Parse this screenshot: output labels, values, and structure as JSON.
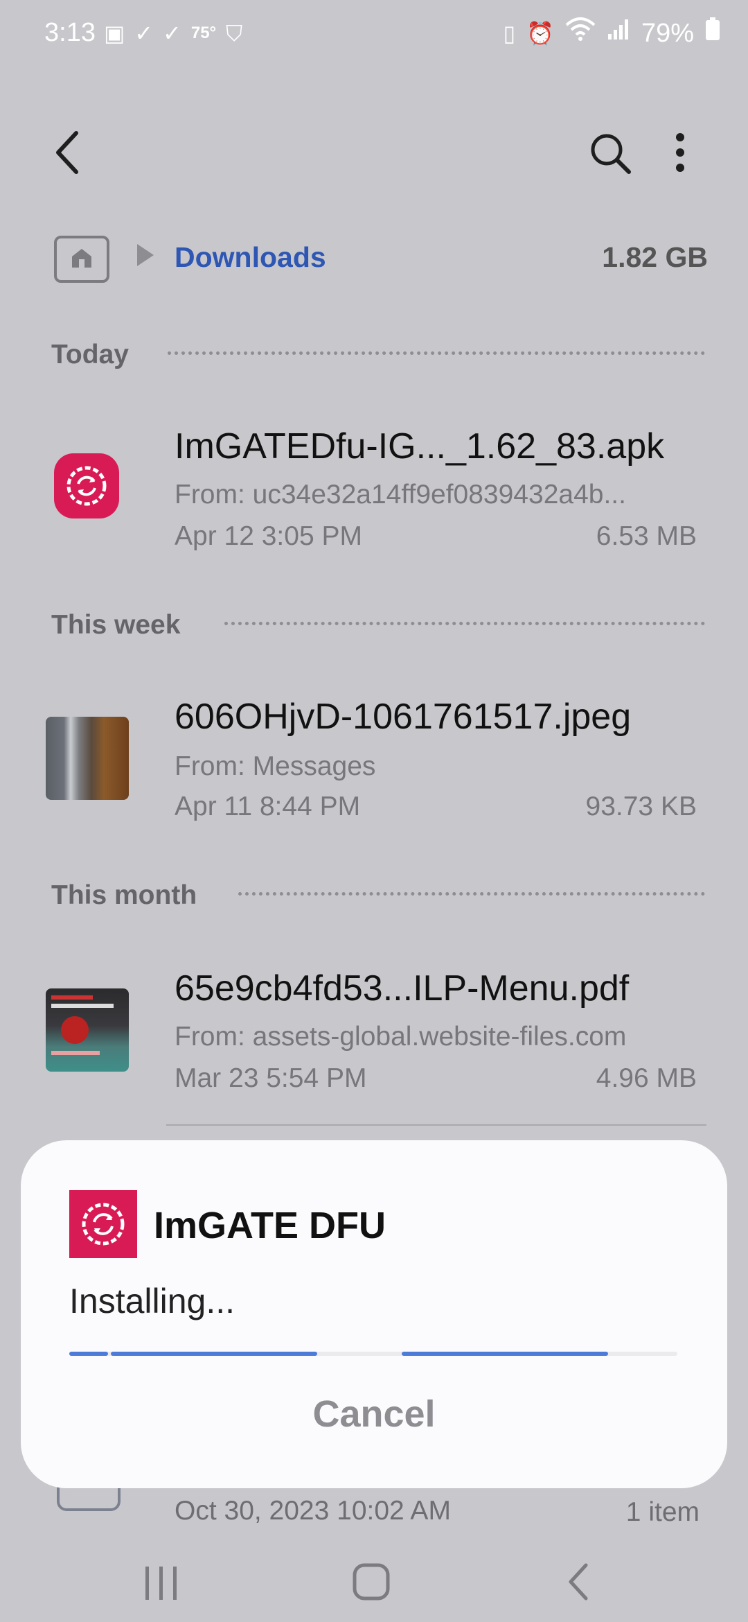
{
  "status_bar": {
    "time": "3:13",
    "temperature": "75°",
    "battery": "79%"
  },
  "toolbar": {
    "back_icon": "chevron-left-icon",
    "search_icon": "search-icon",
    "more_icon": "more-vertical-icon"
  },
  "breadcrumb": {
    "current": "Downloads",
    "storage": "1.82 GB"
  },
  "sections": {
    "today": "Today",
    "this_week": "This week",
    "this_month": "This month"
  },
  "files": [
    {
      "name": "ImGATEDfu-IG..._1.62_83.apk",
      "from": "From: uc34e32a14ff9ef0839432a4b...",
      "date": "Apr 12 3:05 PM",
      "size": "6.53 MB"
    },
    {
      "name": "606OHjvD-1061761517.jpeg",
      "from": "From: Messages",
      "date": "Apr 11 8:44 PM",
      "size": "93.73 KB"
    },
    {
      "name": "65e9cb4fd53...ILP-Menu.pdf",
      "from": "From: assets-global.website-files.com",
      "date": "Mar 23 5:54 PM",
      "size": "4.96 MB"
    }
  ],
  "peek_row": {
    "date": "Oct 30, 2023 10:02 AM",
    "count": "1 item"
  },
  "install_sheet": {
    "app_name": "ImGATE DFU",
    "status": "Installing...",
    "cancel_label": "Cancel"
  },
  "colors": {
    "accent_blue": "#2e56b3",
    "progress_blue": "#4c7bd8",
    "app_icon_red": "#d81b54"
  }
}
